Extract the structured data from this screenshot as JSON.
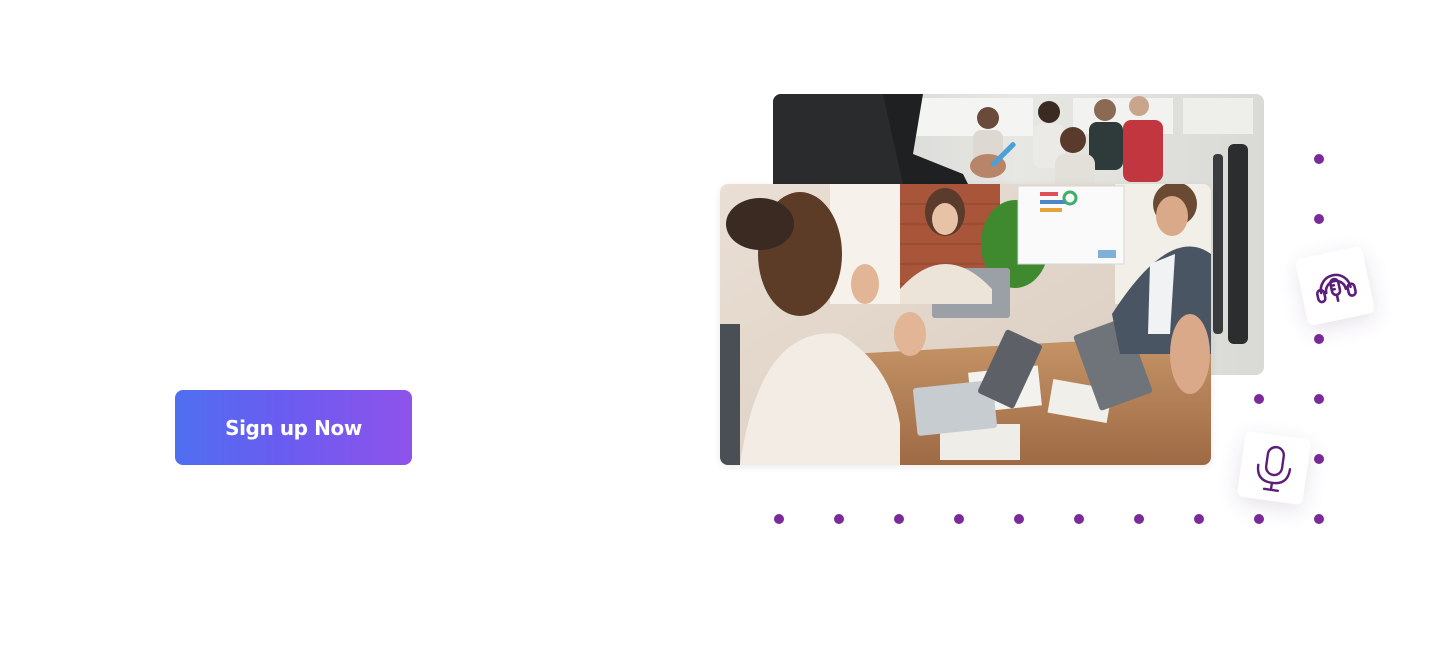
{
  "cta": {
    "label": "Sign up Now"
  },
  "images": {
    "back": "presenter-in-meeting-photo",
    "front": "team-applauding-photo"
  },
  "icons": {
    "podcast": "podcast-icon",
    "microphone": "microphone-icon"
  },
  "colors": {
    "dot": "#7a2a99",
    "icon": "#5b1f7a",
    "button_gradient_start": "#4f6ff0",
    "button_gradient_end": "#8e53ea",
    "button_text": "#ffffff"
  }
}
